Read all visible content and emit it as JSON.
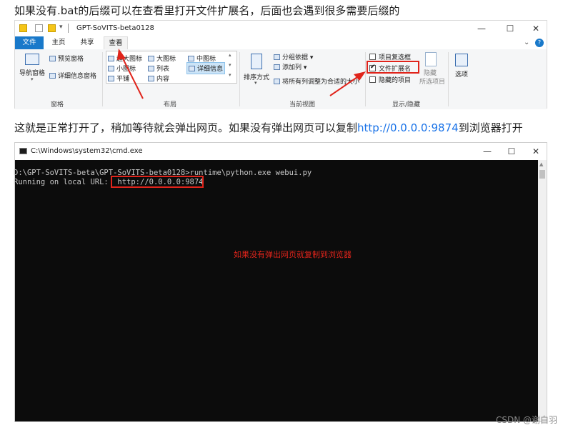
{
  "intro_text": "如果没有.bat的后缀可以在查看里打开文件扩展名，后面也会遇到很多需要后缀的",
  "explorer": {
    "window_title": "GPT-SoVITS-beta0128",
    "quick_access_arrow": "▾",
    "window_buttons": {
      "minimize": "—",
      "maximize": "☐",
      "close": "✕"
    },
    "tabs": [
      "文件",
      "主页",
      "共享",
      "查看"
    ],
    "help_chevron": "⌄",
    "help_icon": "?",
    "ribbon": {
      "pane_group": {
        "nav_pane": "导航窗格",
        "preview_pane": "预览窗格",
        "details_pane": "详细信息窗格",
        "label": "窗格"
      },
      "layout_group": {
        "items": [
          "超大图标",
          "大图标",
          "中图标",
          "小图标",
          "列表",
          "详细信息",
          "平铺",
          "内容"
        ],
        "label": "布局"
      },
      "current_view_group": {
        "sort_by": "排序方式",
        "group_by": "分组依据",
        "add_column": "添加列",
        "fit_columns": "将所有列调整为合适的大小",
        "label": "当前视图"
      },
      "show_hide_group": {
        "item_checkboxes": "项目复选框",
        "file_extensions": "文件扩展名",
        "hidden_items": "隐藏的项目",
        "hide": "隐藏",
        "hide_selected": "所选项目",
        "label": "显示/隐藏",
        "item_checkboxes_checked": false,
        "file_extensions_checked": true,
        "hidden_items_checked": false
      },
      "options": "选项"
    }
  },
  "middle_text": {
    "before": "这就是正常打开了，稍加等待就会弹出网页。如果没有弹出网页可以复制",
    "link": "http://0.0.0.0:9874",
    "after": "到浏览器打开"
  },
  "cmd": {
    "window_title": "C:\\Windows\\system32\\cmd.exe",
    "lines": [
      "D:\\GPT-SoVITS-beta\\GPT-SoVITS-beta0128>runtime\\python.exe webui.py",
      "Running on local URL:  http://0.0.0.0:9874"
    ],
    "annotation": "如果没有弹出网页就复制到浏览器"
  },
  "watermark": "CSDN @谢白羽",
  "colors": {
    "accent_red": "#e0241b",
    "file_tab_blue": "#1979ca",
    "link_blue": "#1a73e8"
  }
}
